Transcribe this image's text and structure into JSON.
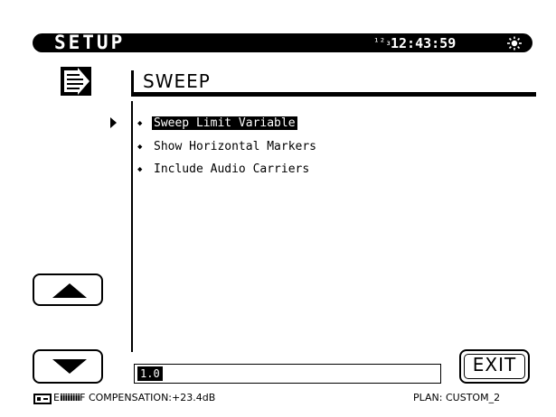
{
  "title_bar": {
    "title": "SETUP",
    "status_indicator": "¹²₃",
    "time": "12:43:59",
    "icon": "sun-icon"
  },
  "section": {
    "icon": "page-arrow-icon",
    "heading": "SWEEP"
  },
  "menu": {
    "items": [
      {
        "label": "Sweep Limit Variable",
        "selected": true
      },
      {
        "label": "Show Horizontal Markers",
        "selected": false
      },
      {
        "label": "Include Audio Carriers",
        "selected": false
      }
    ]
  },
  "buttons": {
    "up_icon": "up-arrow-icon",
    "down_icon": "down-arrow-icon",
    "exit_label": "EXIT"
  },
  "value_field": {
    "value": "1.0"
  },
  "status_bar": {
    "battery_icon": "battery-icon",
    "meter_prefix": "E",
    "meter": "iiiiiiii",
    "meter_suffix": "F",
    "compensation_label": "COMPENSATION:",
    "compensation_value": "+23.4dB",
    "plan_label": "PLAN:",
    "plan_value": "CUSTOM_2"
  }
}
